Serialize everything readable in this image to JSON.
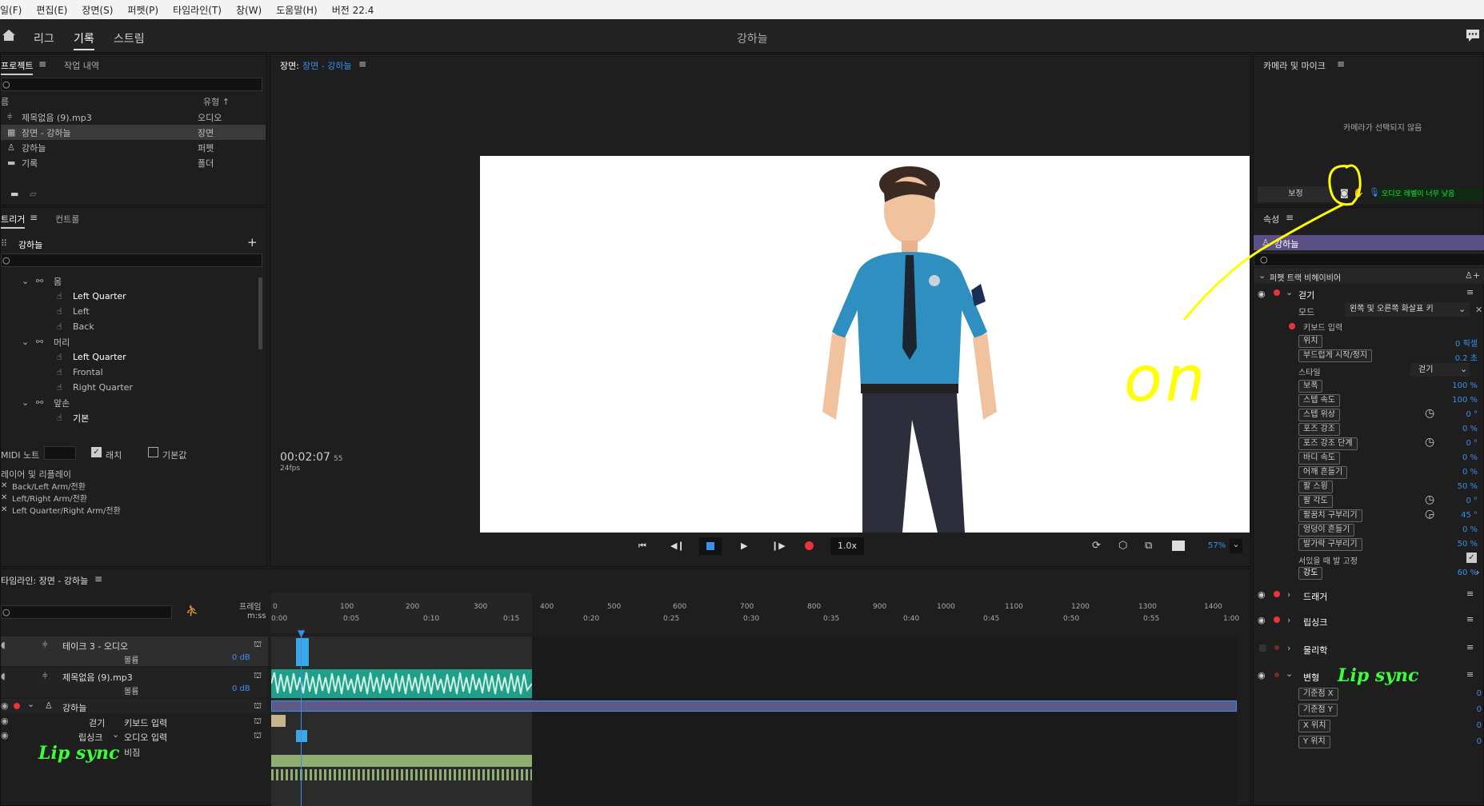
{
  "menu": [
    "일(F)",
    "편집(E)",
    "장면(S)",
    "퍼펫(P)",
    "타임라인(T)",
    "창(W)",
    "도움말(H)",
    "버전 22.4"
  ],
  "workspace": {
    "tabs": [
      "리그",
      "기록",
      "스트림"
    ],
    "active": "기록",
    "title": "강하늘"
  },
  "project": {
    "tabs": [
      "프로젝트",
      "작업 내역"
    ],
    "col_name": "름",
    "col_type": "유형 ↑",
    "items": [
      {
        "name": "제목없음 (9).mp3",
        "type": "오디오"
      },
      {
        "name": "장면 - 강하늘",
        "type": "장면"
      },
      {
        "name": "강하늘",
        "type": "퍼펫"
      },
      {
        "name": "기록",
        "type": "폴더"
      }
    ]
  },
  "triggers": {
    "tabs": [
      "트리거",
      "컨트롤"
    ],
    "puppet": "강하늘",
    "groups": [
      {
        "label": "몸",
        "items": [
          "Left Quarter",
          "Left",
          "Back"
        ]
      },
      {
        "label": "머리",
        "items": [
          "Left Quarter",
          "Frontal",
          "Right Quarter"
        ]
      },
      {
        "label": "앞손",
        "items": [
          "기본"
        ]
      }
    ],
    "midi_label": "MIDI 노트",
    "latch": "래치",
    "default": "기본값",
    "replay_label": "레이어 및 리플레이",
    "swaps": [
      "Back/Left Arm/전환",
      "Left/Right Arm/전환",
      "Left Quarter/Right Arm/전환"
    ]
  },
  "scene": {
    "label": "장면:",
    "name": "장면 - 강하늘",
    "timecode": "00:02:07",
    "frames": "55",
    "fps": "24fps",
    "speed": "1.0x",
    "zoom": "57%"
  },
  "camera": {
    "title": "카메라 및 마이크",
    "no_camera": "카메라가 선택되지 않음",
    "rest": "보정",
    "audio_warning": "오디오 레벨이 너무 낮음"
  },
  "properties": {
    "title": "속성",
    "puppet": "강하늘",
    "behaviors_header": "퍼펫 트랙 비헤이비어",
    "walk": "걷기",
    "mode_label": "모드",
    "mode_value": "왼쪽 및 오른쪽 화살표 키",
    "keyboard_input": "키보드 입력",
    "style_label": "스타일",
    "style_value": "걷기",
    "params": [
      {
        "label": "위치",
        "value": "0 픽셀"
      },
      {
        "label": "부드럽게 시작/정지",
        "value": "0.2 초"
      },
      {
        "label": "보폭",
        "value": "100 %"
      },
      {
        "label": "스텝 속도",
        "value": "100 %"
      },
      {
        "label": "스텝 위상",
        "value": "0 °"
      },
      {
        "label": "포즈 강조",
        "value": "0 %"
      },
      {
        "label": "포즈 강조 단계",
        "value": "0 °"
      },
      {
        "label": "바디 속도",
        "value": "0 %"
      },
      {
        "label": "어깨 흔들기",
        "value": "0 %"
      },
      {
        "label": "팔 스윙",
        "value": "50 %"
      },
      {
        "label": "팔 각도",
        "value": "0 °"
      },
      {
        "label": "팔꿈치 구부리기",
        "value": "45 °"
      },
      {
        "label": "엉덩이 흔들기",
        "value": "0 %"
      },
      {
        "label": "발가락 구부리기",
        "value": "50 %"
      }
    ],
    "plant_feet": "서있을 때 발 고정",
    "strength_label": "강도",
    "strength_value": "60 %",
    "other_behaviors": [
      "드래거",
      "립싱크",
      "물리학",
      "변형"
    ],
    "transform": [
      {
        "label": "기준점 X",
        "value": "0"
      },
      {
        "label": "기준점 Y",
        "value": "0"
      },
      {
        "label": "X 위치",
        "value": "0"
      },
      {
        "label": "Y 위치",
        "value": "0"
      }
    ]
  },
  "timeline": {
    "title": "타임라인: 장면 - 강하늘",
    "frame_label": "프레임",
    "mss_label": "m:ss",
    "frame_ticks": [
      "0",
      "100",
      "200",
      "300",
      "400",
      "500",
      "600",
      "700",
      "800",
      "900",
      "1000",
      "1100",
      "1200",
      "1300",
      "1400"
    ],
    "time_ticks": [
      "0:00",
      "0:05",
      "0:10",
      "0:15",
      "0:20",
      "0:25",
      "0:30",
      "0:35",
      "0:40",
      "0:45",
      "0:50",
      "0:55",
      "1:00"
    ],
    "tracks": [
      {
        "name": "테이크 3 - 오디오",
        "sub": "볼륨",
        "db": "0 dB"
      },
      {
        "name": "제목없음 (9).mp3",
        "sub": "볼륨",
        "db": "0 dB"
      },
      {
        "name": "강하늘"
      }
    ],
    "walk_row": {
      "behavior": "걷기",
      "param": "키보드 입력"
    },
    "lipsync_row": {
      "behavior": "립싱크",
      "param": "오디오 입력"
    },
    "viseme_label": "비짐"
  },
  "annotations": {
    "on": "on",
    "lip_sync": "Lip sync"
  },
  "colors": {
    "accent": "#3b8eea",
    "audio_clip": "#1f9e8a",
    "puppet_track": "#5d5a86",
    "annotation_yellow": "#ffff00",
    "annotation_green": "#3cff3c"
  }
}
